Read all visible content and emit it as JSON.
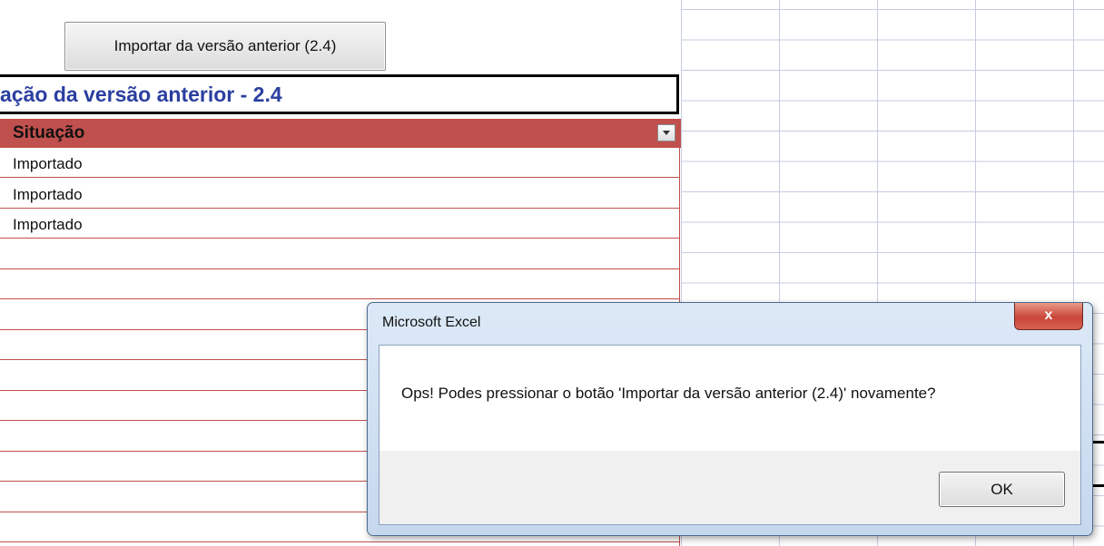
{
  "sheet": {
    "import_button_label": "Importar da versão anterior (2.4)",
    "section_title": "ação da versão anterior - 2.4",
    "column_header": "Situação",
    "rows": [
      "Importado",
      "Importado",
      "Importado",
      "",
      "",
      "",
      "",
      "",
      "",
      "",
      "",
      "",
      ""
    ]
  },
  "dialog": {
    "title": "Microsoft Excel",
    "close_label": "x",
    "message": "Ops! Podes pressionar o botão 'Importar da versão anterior (2.4)' novamente?",
    "ok_label": "OK"
  },
  "colors": {
    "header_fill": "#c0504d",
    "title_text": "#2b3fa0",
    "row_border": "#c0504d"
  }
}
